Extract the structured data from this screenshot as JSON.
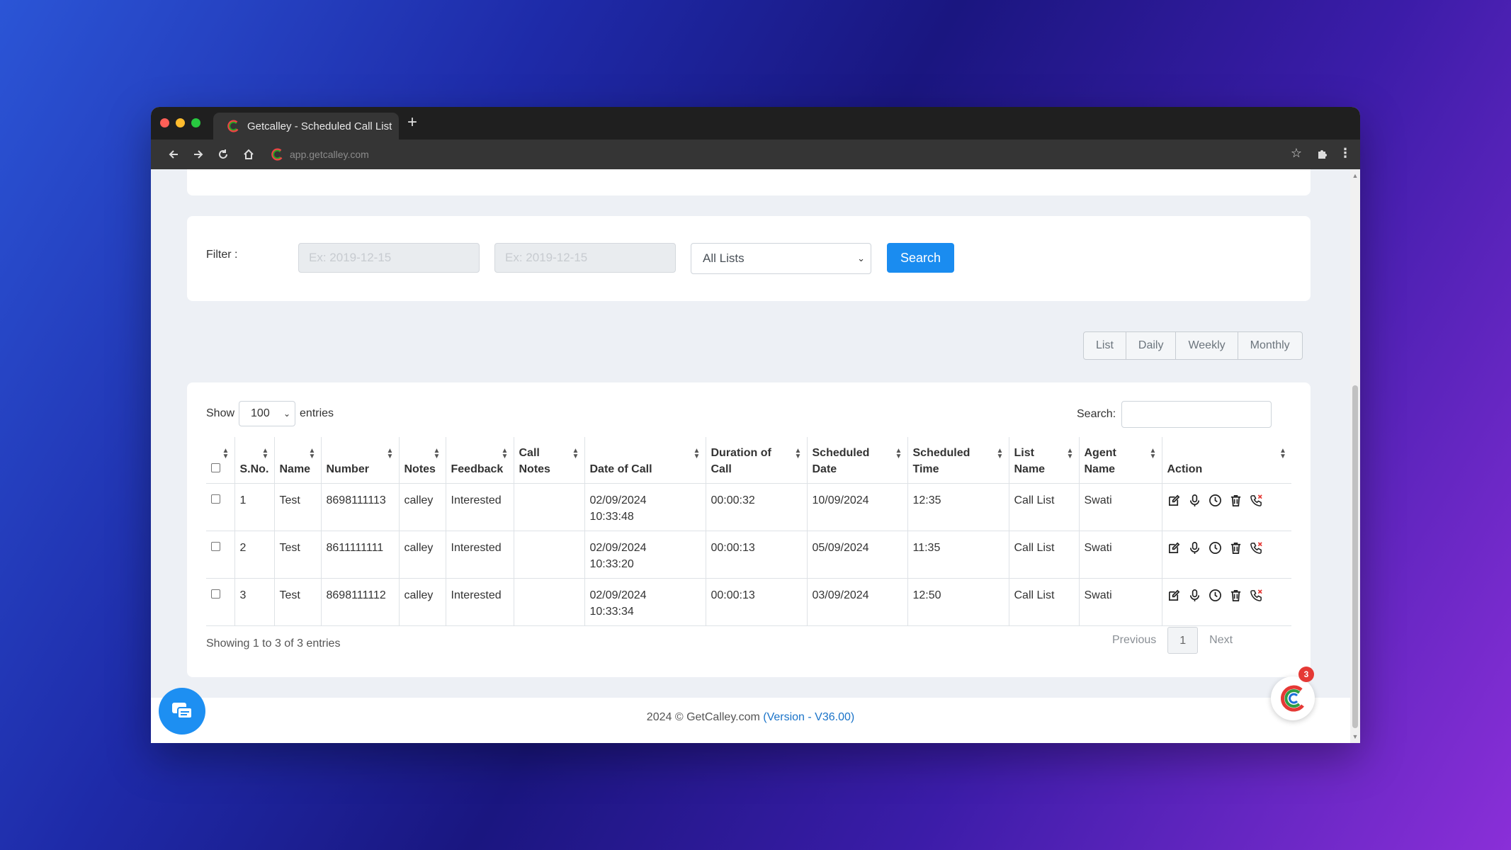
{
  "browser": {
    "tab_title": "Getcalley - Scheduled Call List",
    "url": "app.getcalley.com",
    "new_tab": "+"
  },
  "filter": {
    "label": "Filter :",
    "from_placeholder": "Ex: 2019-12-15",
    "to_placeholder": "Ex: 2019-12-15",
    "list_select": "All Lists",
    "search_button": "Search"
  },
  "views": [
    "List",
    "Daily",
    "Weekly",
    "Monthly"
  ],
  "table": {
    "show_label": "Show",
    "entries_value": "100",
    "entries_label": "entries",
    "search_label": "Search:",
    "columns": [
      "S.No.",
      "Name",
      "Number",
      "Notes",
      "Feedback",
      "Call Notes",
      "Date of Call",
      "Duration of Call",
      "Scheduled Date",
      "Scheduled Time",
      "List Name",
      "Agent Name",
      "Action"
    ],
    "rows": [
      {
        "sno": "1",
        "name": "Test",
        "number": "8698111113",
        "notes": "calley",
        "feedback": "Interested",
        "call_notes": "",
        "date_of_call": "02/09/2024",
        "time_of_call": "10:33:48",
        "duration": "00:00:32",
        "scheduled_date": "10/09/2024",
        "scheduled_time": "12:35",
        "list_name": "Call List",
        "agent": "Swati"
      },
      {
        "sno": "2",
        "name": "Test",
        "number": "8611111111",
        "notes": "calley",
        "feedback": "Interested",
        "call_notes": "",
        "date_of_call": "02/09/2024",
        "time_of_call": "10:33:20",
        "duration": "00:00:13",
        "scheduled_date": "05/09/2024",
        "scheduled_time": "11:35",
        "list_name": "Call List",
        "agent": "Swati"
      },
      {
        "sno": "3",
        "name": "Test",
        "number": "8698111112",
        "notes": "calley",
        "feedback": "Interested",
        "call_notes": "",
        "date_of_call": "02/09/2024",
        "time_of_call": "10:33:34",
        "duration": "00:00:13",
        "scheduled_date": "03/09/2024",
        "scheduled_time": "12:50",
        "list_name": "Call List",
        "agent": "Swati"
      }
    ],
    "info": "Showing 1 to 3 of 3 entries",
    "pager": {
      "previous": "Previous",
      "current": "1",
      "next": "Next"
    }
  },
  "footer": {
    "text": "2024 © GetCalley.com ",
    "version": "(Version - V36.00)"
  },
  "widget": {
    "badge": "3"
  },
  "icons": [
    "edit-icon",
    "microphone-icon",
    "clock-icon",
    "trash-icon",
    "phone-icon"
  ],
  "colors": {
    "accent": "#1a8cf0",
    "link": "#1a73c8",
    "badge": "#e53935"
  }
}
